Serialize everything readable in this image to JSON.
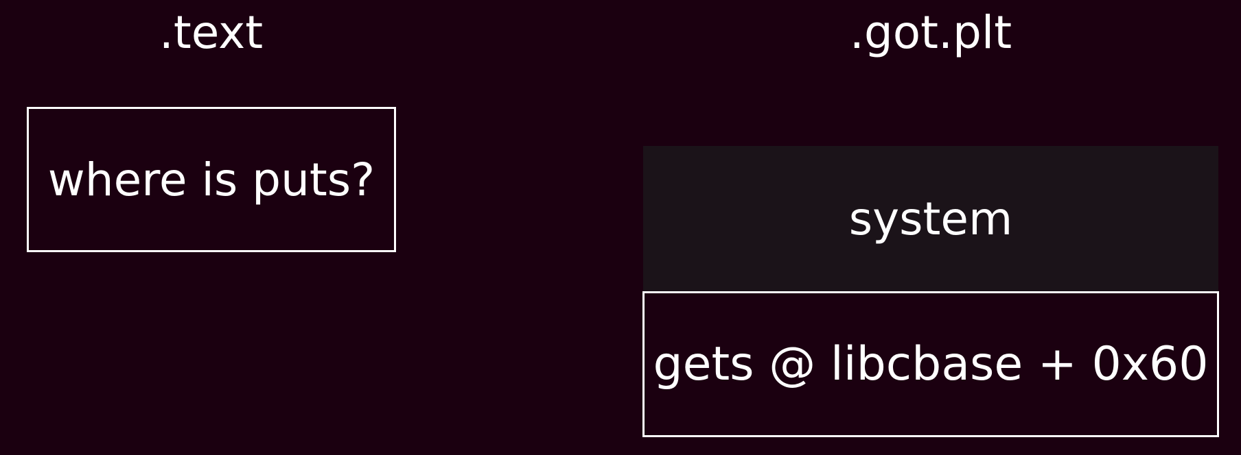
{
  "text_section": {
    "title": ".text",
    "box_label": "where is puts?"
  },
  "got_plt_section": {
    "title": ".got.plt",
    "entries": [
      {
        "label": "system",
        "style": "filled"
      },
      {
        "label": "gets @ libcbase + 0x60",
        "style": "outlined"
      }
    ]
  },
  "colors": {
    "background": "#1b0010",
    "filled_entry": "#1b1319",
    "text_and_border": "#ffffff"
  }
}
